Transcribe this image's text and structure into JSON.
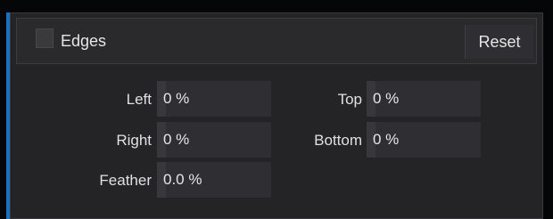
{
  "panel": {
    "title": "Edges",
    "reset_label": "Reset",
    "enabled": false
  },
  "fields": {
    "left": {
      "label": "Left",
      "value": "0 %"
    },
    "right": {
      "label": "Right",
      "value": "0 %"
    },
    "feather": {
      "label": "Feather",
      "value": "0.0 %"
    },
    "top": {
      "label": "Top",
      "value": "0 %"
    },
    "bottom": {
      "label": "Bottom",
      "value": "0 %"
    }
  },
  "colors": {
    "accent": "#1f6fbf",
    "panel_bg": "#242427",
    "field_bg": "#2f2f33",
    "text": "#e6e6e6"
  }
}
